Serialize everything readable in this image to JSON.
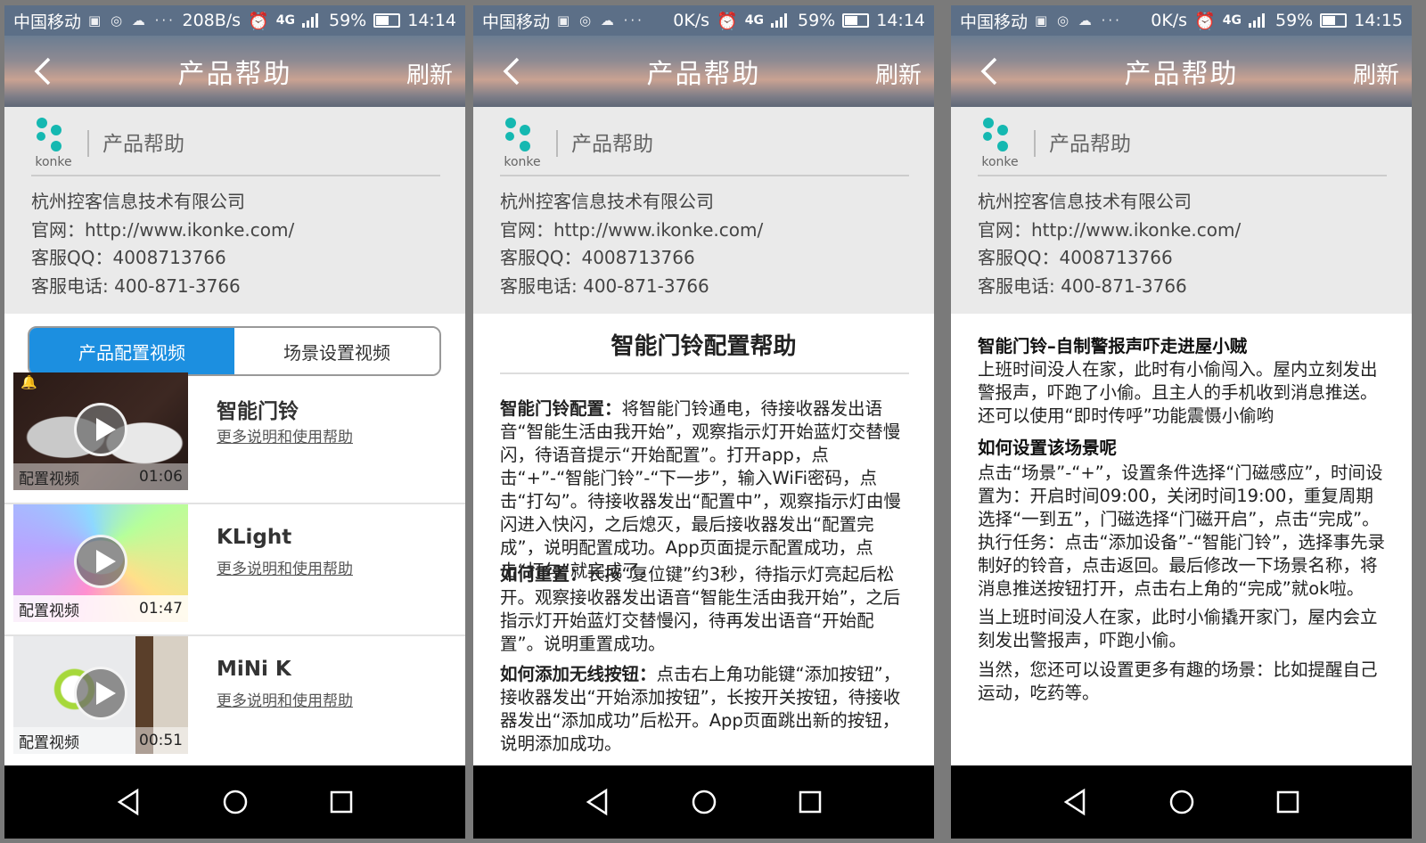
{
  "screens": [
    {
      "status": {
        "carrier": "中国移动",
        "speed": "208B/s",
        "battery": "59%",
        "battery_level": 0.59,
        "time": "14:14"
      },
      "header": {
        "title": "产品帮助",
        "refresh": "刷新"
      }
    },
    {
      "status": {
        "carrier": "中国移动",
        "speed": "0K/s",
        "battery": "59%",
        "battery_level": 0.59,
        "time": "14:14"
      },
      "header": {
        "title": "产品帮助",
        "refresh": "刷新"
      }
    },
    {
      "status": {
        "carrier": "中国移动",
        "speed": "0K/s",
        "battery": "59%",
        "battery_level": 0.59,
        "time": "14:15"
      },
      "header": {
        "title": "产品帮助",
        "refresh": "刷新"
      }
    }
  ],
  "network": {
    "label": "4G",
    "sub": "4G"
  },
  "info": {
    "logo_text": "konke",
    "brand": "产品帮助",
    "company": "杭州控客信息技术有限公司",
    "website": "官网：http://www.ikonke.com/",
    "qq": "客服QQ：4008713766",
    "phone": "客服电话: 400-871-3766"
  },
  "tabs": {
    "config": "产品配置视频",
    "scene": "场景设置视频"
  },
  "videos": [
    {
      "title": "智能门铃",
      "link": "更多说明和使用帮助",
      "caption": "配置视频",
      "duration": "01:06"
    },
    {
      "title": "KLight",
      "link": "更多说明和使用帮助",
      "caption": "配置视频",
      "duration": "01:47"
    },
    {
      "title": "MiNi K",
      "link": "更多说明和使用帮助",
      "caption": "配置视频",
      "duration": "00:51"
    }
  ],
  "help": {
    "title": "智能门铃配置帮助",
    "sections": [
      {
        "label": "智能门铃配置：",
        "text": "将智能门铃通电，待接收器发出语音“智能生活由我开始”，观察指示灯开始蓝灯交替慢闪，待语音提示“开始配置”。打开app，点击“+”-“智能门铃”-“下一步”，输入WiFi密码，点击“打勾”。待接收器发出“配置中”，观察指示灯由慢闪进入快闪，之后熄灭，最后接收器发出“配置完成”，说明配置成功。App页面提示配置成功，点击“打勾”就完成了。"
      },
      {
        "label": "如何重置：",
        "text": "长按“复位键”约3秒，待指示灯亮起后松开。观察接收器发出语音“智能生活由我开始”，之后指示灯开始蓝灯交替慢闪，待再发出语音“开始配置”。说明重置成功。"
      },
      {
        "label": "如何添加无线按钮：",
        "text": "点击右上角功能键“添加按钮”，接收器发出“开始添加按钮”，长按开关按钮，待接收器发出“添加成功”后松开。App页面跳出新的按钮，说明添加成功。"
      }
    ]
  },
  "scene": {
    "title": "智能门铃–自制警报声吓走进屋小贼",
    "intro": "上班时间没人在家，此时有小偷闯入。屋内立刻发出警报声，吓跑了小偷。且主人的手机收到消息推送。还可以使用“即时传呼”功能震慑小偷哟",
    "how_title": "如何设置该场景呢",
    "steps": "点击“场景”-“+”，设置条件选择“门磁感应”，时间设置为：开启时间09:00，关闭时间19:00，重复周期选择“一到五”，门磁选择“门磁开启”，点击“完成”。执行任务：点击“添加设备”-“智能门铃”，选择事先录制好的铃音，点击返回。最后修改一下场景名称，将消息推送按钮打开，点击右上角的“完成”就ok啦。",
    "result": "当上班时间没人在家，此时小偷撬开家门，屋内会立刻发出警报声，吓跑小偷。",
    "more": "当然，您还可以设置更多有趣的场景：比如提醒自己运动，吃药等。"
  },
  "colors": {
    "accent": "#1c8fe0",
    "logo": "#15b8b1",
    "statusbar": "#5c6f87"
  }
}
